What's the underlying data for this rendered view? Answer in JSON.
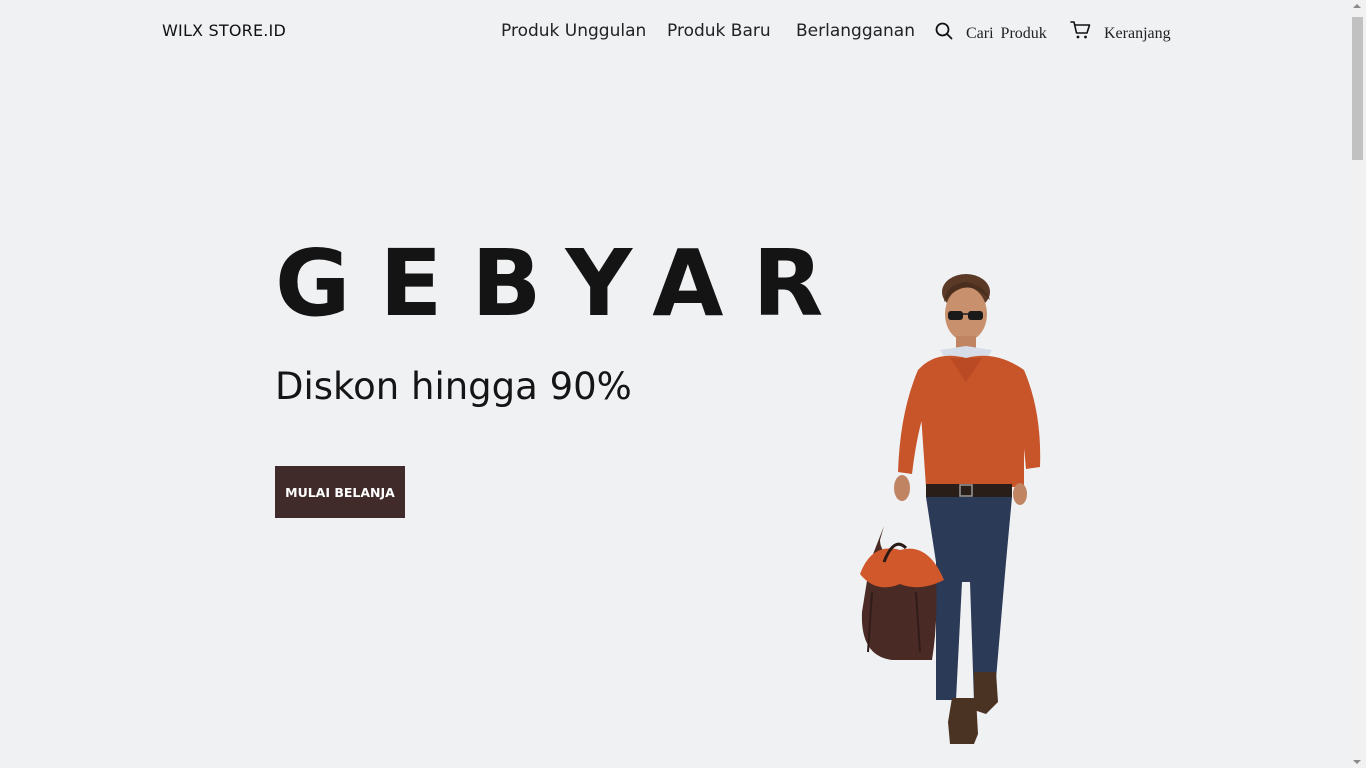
{
  "brand": {
    "name": "WILX STORE.ID"
  },
  "nav": {
    "links": [
      "Produk Unggulan",
      "Produk Baru",
      "Berlangganan"
    ],
    "search_label": "Cari  Produk",
    "cart_label": "Keranjang"
  },
  "hero": {
    "title": "GEBYAR",
    "subtitle": "Diskon hingga 90%",
    "cta_label": "MULAI BELANJA"
  },
  "icons": {
    "search": "search-icon",
    "cart": "cart-icon",
    "model": "fashion-model-image"
  },
  "colors": {
    "background": "#f0f1f3",
    "cta": "#412a2a",
    "text": "#111111"
  }
}
